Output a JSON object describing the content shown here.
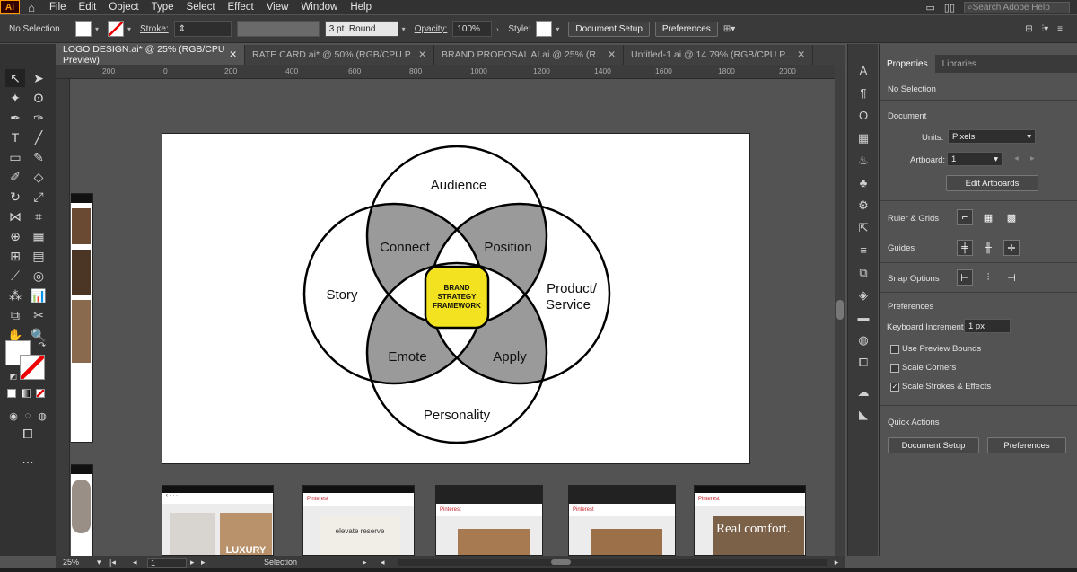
{
  "app": {
    "logo": "Ai",
    "search_placeholder": "Search Adobe Help"
  },
  "menu": [
    "File",
    "Edit",
    "Object",
    "Type",
    "Select",
    "Effect",
    "View",
    "Window",
    "Help"
  ],
  "control_bar": {
    "selection": "No Selection",
    "stroke_label": "Stroke:",
    "brush": "3 pt. Round",
    "opacity_label": "Opacity:",
    "opacity_value": "100%",
    "style_label": "Style:",
    "document_setup": "Document Setup",
    "preferences": "Preferences"
  },
  "tabs": [
    {
      "label": "LOGO DESIGN.ai* @ 25% (RGB/CPU Preview)"
    },
    {
      "label": "RATE CARD.ai* @ 50% (RGB/CPU P..."
    },
    {
      "label": "BRAND PROPOSAL AI.ai @ 25% (R..."
    },
    {
      "label": "Untitled-1.ai @ 14.79% (RGB/CPU P..."
    }
  ],
  "ruler": {
    "h": [
      "200",
      "0",
      "200",
      "400",
      "600",
      "800",
      "1000",
      "1200",
      "1400",
      "1600",
      "1800",
      "2000"
    ]
  },
  "diagram": {
    "circles": [
      "Audience",
      "Story",
      "Personality"
    ],
    "product_line1": "Product/",
    "product_line2": "Service",
    "overlaps": [
      "Connect",
      "Position",
      "Emote",
      "Apply"
    ],
    "center_line1": "BRAND",
    "center_line2": "STRATEGY",
    "center_line3": "FRAMEWORK",
    "colors": {
      "overlap": "#9a9a9a",
      "center": "#f2e21f",
      "stroke": "#000000"
    }
  },
  "thumbnails": [
    {
      "header": "Pinterest",
      "big_text": "LUXURY"
    },
    {
      "header": "Pinterest",
      "big_text": "elevate reserve"
    },
    {
      "header": "Pinterest",
      "big_text": ""
    },
    {
      "header": "Pinterest",
      "big_text": ""
    },
    {
      "header": "Pinterest",
      "big_text": "Real comfort."
    }
  ],
  "properties": {
    "tabs": [
      "Properties",
      "Libraries"
    ],
    "selection": "No Selection",
    "document_heading": "Document",
    "units_label": "Units:",
    "units_value": "Pixels",
    "artboard_label": "Artboard:",
    "artboard_value": "1",
    "edit_artboards": "Edit Artboards",
    "ruler_grids": "Ruler & Grids",
    "guides": "Guides",
    "snap_options": "Snap Options",
    "preferences_heading": "Preferences",
    "keyboard_increment_label": "Keyboard Increment:",
    "keyboard_increment_value": "1 px",
    "use_preview_bounds": "Use Preview Bounds",
    "scale_corners": "Scale Corners",
    "scale_strokes": "Scale Strokes & Effects",
    "quick_actions": "Quick Actions",
    "document_setup": "Document Setup",
    "preferences": "Preferences"
  },
  "status": {
    "zoom": "25%",
    "page": "1",
    "mode": "Selection"
  }
}
